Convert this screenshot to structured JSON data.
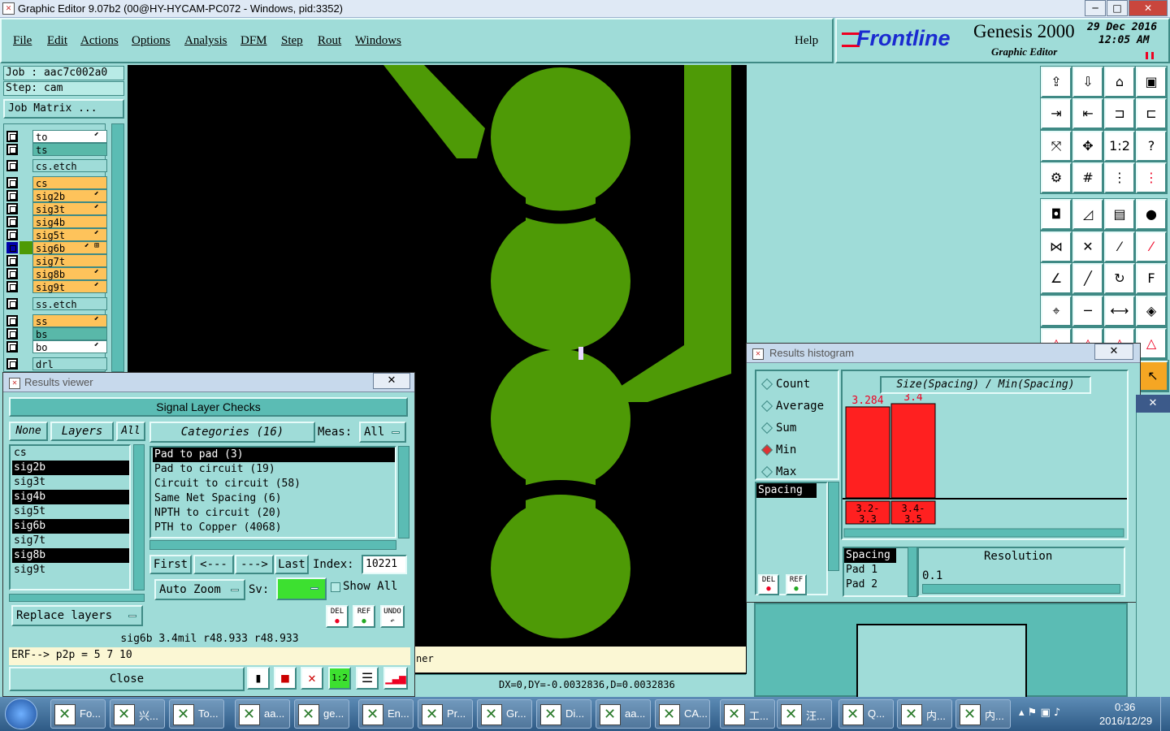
{
  "window": {
    "title": "Graphic Editor 9.07b2 (00@HY-HYCAM-PC072 - Windows, pid:3352)",
    "min": "─",
    "max": "□",
    "close": "✕"
  },
  "menu": {
    "items": [
      "File",
      "Edit",
      "Actions",
      "Options",
      "Analysis",
      "DFM",
      "Step",
      "Rout",
      "Windows"
    ],
    "help": "Help"
  },
  "brand": {
    "logo": "Frontline",
    "product": "Genesis 2000",
    "sub": "Graphic Editor",
    "date": "29 Dec 2016",
    "time": "12:05 AM"
  },
  "job": {
    "job": "Job : aac7c002a0",
    "step": "Step: cam",
    "matrix": "Job Matrix ..."
  },
  "layers": [
    {
      "name": "to",
      "color": "white",
      "mark": "⬋"
    },
    {
      "name": "ts",
      "color": "teal2",
      "mark": ""
    },
    {
      "name": "cs.etch",
      "color": "teal",
      "mark": ""
    },
    {
      "name": "cs",
      "color": "orange",
      "mark": ""
    },
    {
      "name": "sig2b",
      "color": "orange",
      "mark": "⬋"
    },
    {
      "name": "sig3t",
      "color": "orange",
      "mark": "⬋"
    },
    {
      "name": "sig4b",
      "color": "orange",
      "mark": ""
    },
    {
      "name": "sig5t",
      "color": "orange",
      "mark": "⬋"
    },
    {
      "name": "sig6b",
      "color": "orange",
      "mark": "⬋ ⊞"
    },
    {
      "name": "sig7t",
      "color": "orange",
      "mark": ""
    },
    {
      "name": "sig8b",
      "color": "orange",
      "mark": "⬋"
    },
    {
      "name": "sig9t",
      "color": "orange",
      "mark": "⬋"
    },
    {
      "name": "ss.etch",
      "color": "teal",
      "mark": ""
    },
    {
      "name": "ss",
      "color": "orange",
      "mark": "⬋"
    },
    {
      "name": "bs",
      "color": "teal2",
      "mark": ""
    },
    {
      "name": "bo",
      "color": "white",
      "mark": "⬋"
    },
    {
      "name": "drl",
      "color": "teal",
      "mark": ""
    }
  ],
  "colors": {
    "copper": "#4e9a06",
    "canvas": "#000000",
    "panel": "#9fdcd8",
    "bar": "#ff2020"
  },
  "results_viewer": {
    "title": "Results viewer",
    "header": "Signal Layer Checks",
    "none": "None",
    "layers": "Layers",
    "all": "All",
    "categories": "Categories (16)",
    "meas_label": "Meas:",
    "meas_value": "All",
    "layer_list": [
      "cs",
      "sig2b",
      "sig3t",
      "sig4b",
      "sig5t",
      "sig6b",
      "sig7t",
      "sig8b",
      "sig9t"
    ],
    "category_list": [
      "Pad to pad (3)",
      "Pad to circuit (19)",
      "Circuit to circuit (58)",
      "Same Net Spacing (6)",
      "NPTH to circuit (20)",
      "PTH to Copper (4068)"
    ],
    "first": "First",
    "prev": "<---",
    "next": "--->",
    "last": "Last",
    "index_label": "Index:",
    "index_value": "10221",
    "auto_zoom": "Auto Zoom",
    "sv_label": "Sv:",
    "show_all": "Show All",
    "replace_layers": "Replace layers",
    "del": "DEL",
    "ref": "REF",
    "undo": "UNDO",
    "status": "sig6b 3.4mil  r48.933  r48.933",
    "erf": "ERF--> p2p = 5 7 10",
    "close": "Close"
  },
  "histogram": {
    "title": "Results histogram",
    "modes": [
      "Count",
      "Average",
      "Sum",
      "Min",
      "Max"
    ],
    "selected_mode": "Min",
    "spacing_list": [
      "Spacing"
    ],
    "chart_title": "Size(Spacing) / Min(Spacing)",
    "bar_values": [
      "3.284",
      "3.4"
    ],
    "bin_labels": [
      [
        "3.2-",
        "3.3"
      ],
      [
        "3.4-",
        "3.5"
      ]
    ],
    "attr_list": [
      "Spacing",
      "Pad 1",
      "Pad 2"
    ],
    "resolution_label": "Resolution",
    "resolution_value": "0.1",
    "del": "DEL",
    "ref": "REF"
  },
  "chart_data": {
    "type": "bar",
    "categories": [
      "3.2-3.3",
      "3.4-3.5"
    ],
    "values": [
      3.284,
      3.4
    ],
    "title": "Size(Spacing) / Min(Spacing)",
    "xlabel": "",
    "ylabel": ""
  },
  "canvas_status": "DX=0,DY=-0.0032836,D=0.0032836",
  "canvas_hint": "ner",
  "taskbar": {
    "items": [
      {
        "label": "Fo..."
      },
      {
        "label": "兴..."
      },
      {
        "label": "To..."
      },
      {
        "label": "aa..."
      },
      {
        "label": "ge..."
      },
      {
        "label": "En..."
      },
      {
        "label": "Pr..."
      },
      {
        "label": "Gr..."
      },
      {
        "label": "Di..."
      },
      {
        "label": "aa..."
      },
      {
        "label": "CA..."
      },
      {
        "label": "工..."
      },
      {
        "label": "汪..."
      },
      {
        "label": "Q..."
      },
      {
        "label": "内..."
      },
      {
        "label": "内..."
      }
    ],
    "time": "0:36",
    "date": "2016/12/29"
  }
}
